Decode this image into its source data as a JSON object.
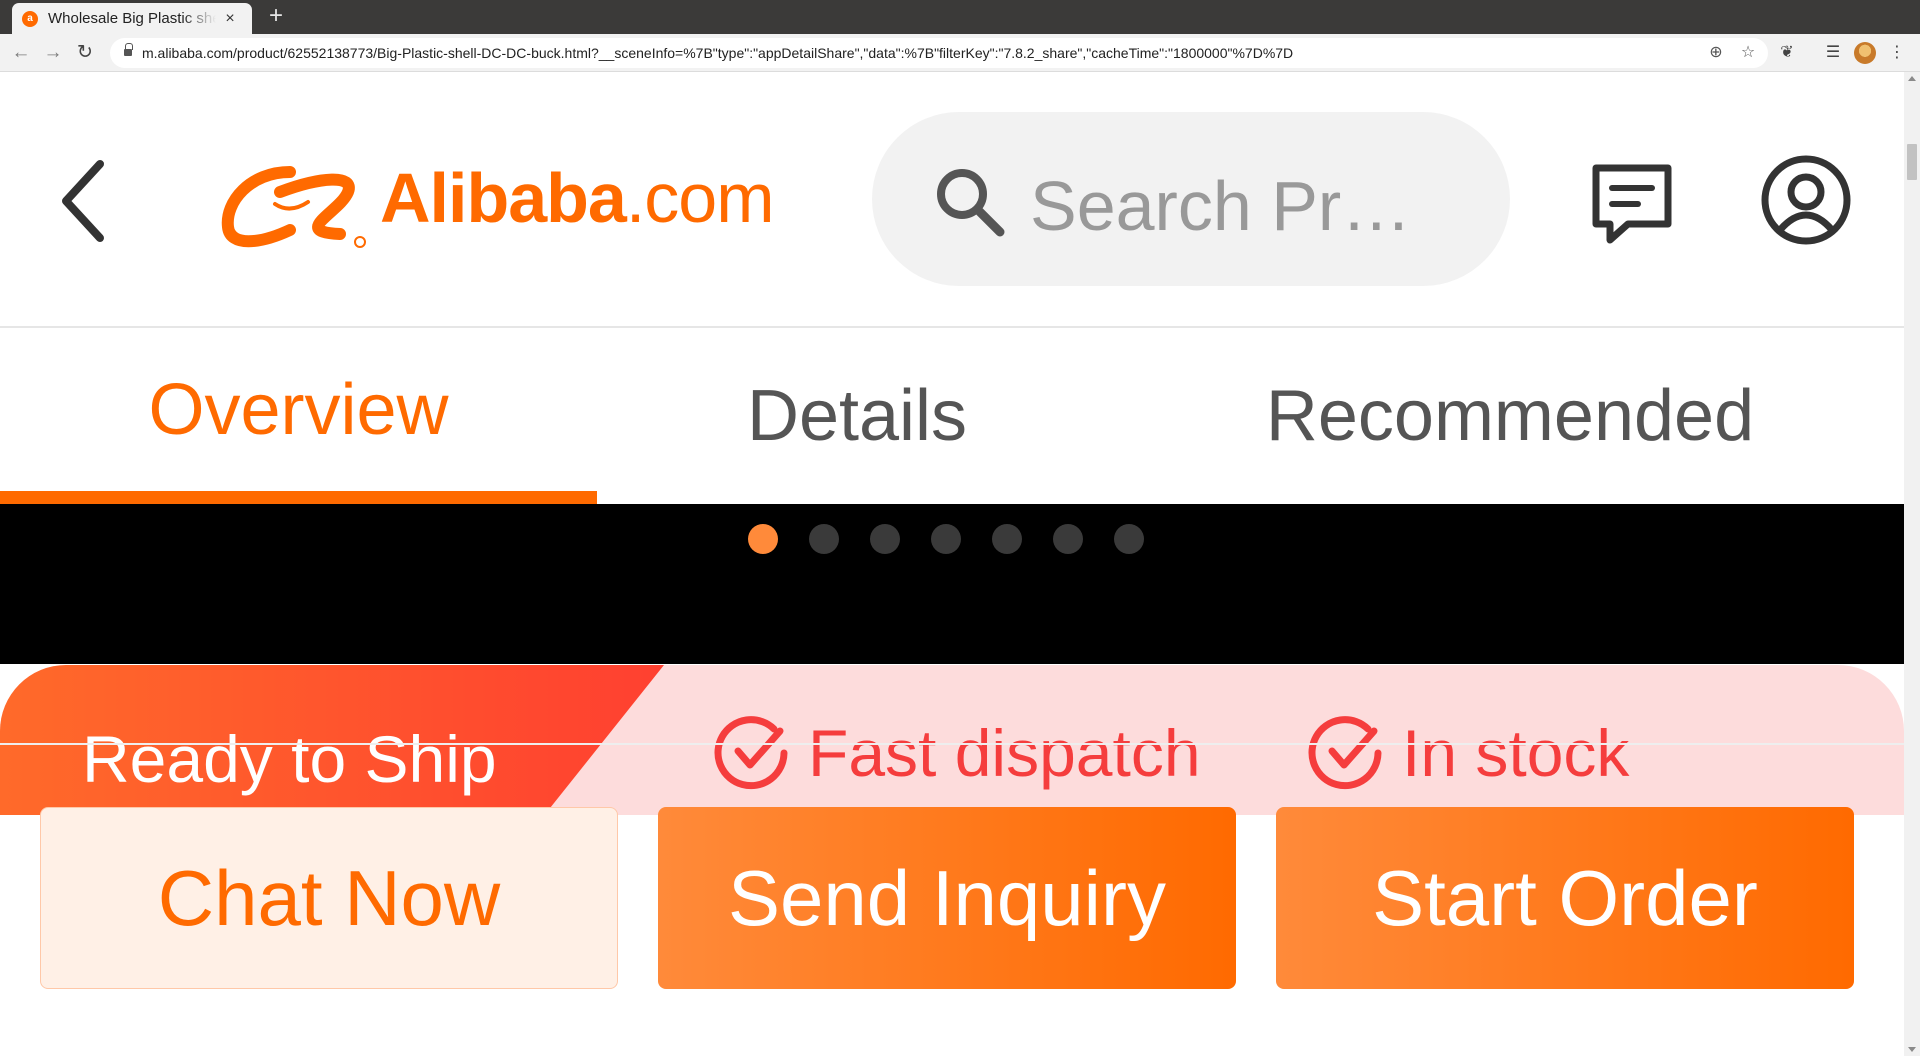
{
  "browser": {
    "tab_title": "Wholesale Big Plastic shell DC-DC buck",
    "new_tab_symbol": "+",
    "close_symbol": "×",
    "url": "m.alibaba.com/product/62552138773/Big-Plastic-shell-DC-DC-buck.html?__sceneInfo=%7B\"type\":\"appDetailShare\",\"data\":%7B\"filterKey\":\"7.8.2_share\",\"cacheTime\":\"1800000\"%7D%7D"
  },
  "header": {
    "logo_brand": "Alibaba",
    "logo_suffix": ".com",
    "search_placeholder": "Search Pr…",
    "brand_color": "#ff6a00"
  },
  "tabs": [
    {
      "label": "Overview",
      "active": true
    },
    {
      "label": "Details",
      "active": false
    },
    {
      "label": "Recommended",
      "active": false
    }
  ],
  "carousel": {
    "dot_count": 7,
    "active_index": 0
  },
  "ready_to_ship": {
    "title": "Ready to Ship",
    "features": [
      {
        "label": "Fast dispatch",
        "icon": "check-circle-icon"
      },
      {
        "label": "In stock",
        "icon": "check-circle-icon"
      }
    ]
  },
  "actions": {
    "chat": "Chat Now",
    "inquiry": "Send Inquiry",
    "order": "Start Order"
  }
}
